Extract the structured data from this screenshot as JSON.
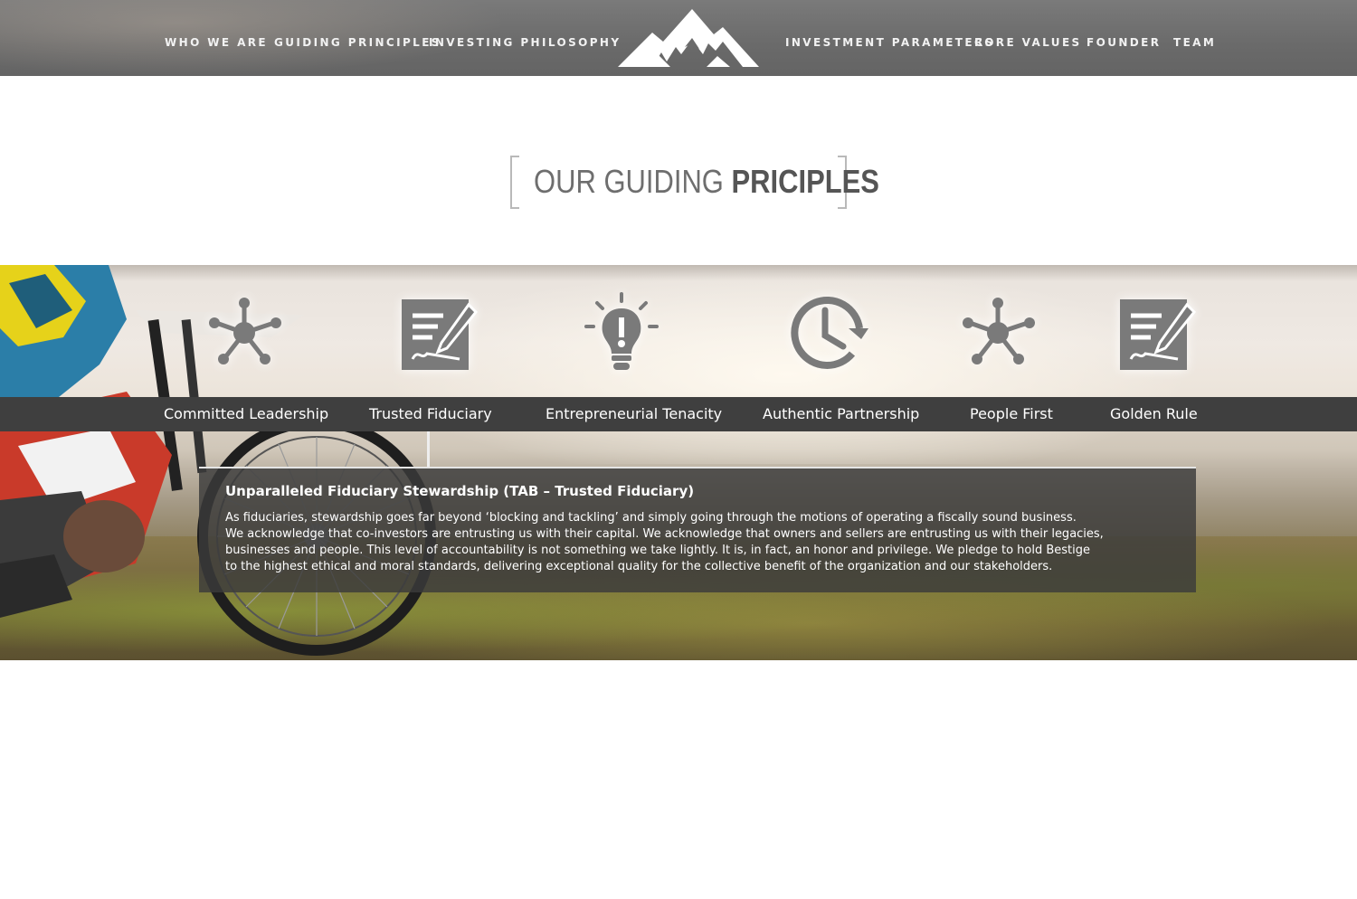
{
  "nav": {
    "left": [
      "WHO WE ARE",
      "GUIDING PRINCIPLES",
      "INVESTING PHILOSOPHY"
    ],
    "right": [
      "INVESTMENT PARAMETERS",
      "CORE VALUES",
      "FOUNDER",
      "TEAM"
    ],
    "logo": "mountain-logo"
  },
  "section": {
    "title_light": "OUR GUIDING ",
    "title_bold": "PRICIPLES"
  },
  "principles": {
    "icons": [
      "network-icon",
      "document-signature-icon",
      "lightbulb-icon",
      "clock-refresh-icon",
      "network-icon",
      "document-signature-icon"
    ],
    "tabs": [
      "Committed Leadership",
      "Trusted Fiduciary",
      "Entrepreneurial Tenacity",
      "Authentic Partnership",
      "People First",
      "Golden Rule"
    ],
    "active_tab": "Trusted Fiduciary"
  },
  "panel": {
    "title": "Unparalleled Fiduciary Stewardship (TAB – Trusted Fiduciary)",
    "text": "As fiduciaries, stewardship goes far beyond ‘blocking and tackling’ and simply going through the motions of operating a fiscally sound business.\nWe acknowledge that co-investors are entrusting us with their capital.  We acknowledge that owners and sellers are entrusting us with their legacies,\nbusinesses and people.  This level of accountability is not something we take lightly.  It is, in fact, an honor and privilege.  We pledge to hold Bestige\nto the highest ethical and moral standards, delivering exceptional quality for the collective benefit of the organization and our stakeholders."
  },
  "colors": {
    "header_bg": "#6b6b6b",
    "tabbar_bg": "#3f3f3f",
    "icon_gray": "#7a7a7a",
    "title_gray": "#666666"
  }
}
